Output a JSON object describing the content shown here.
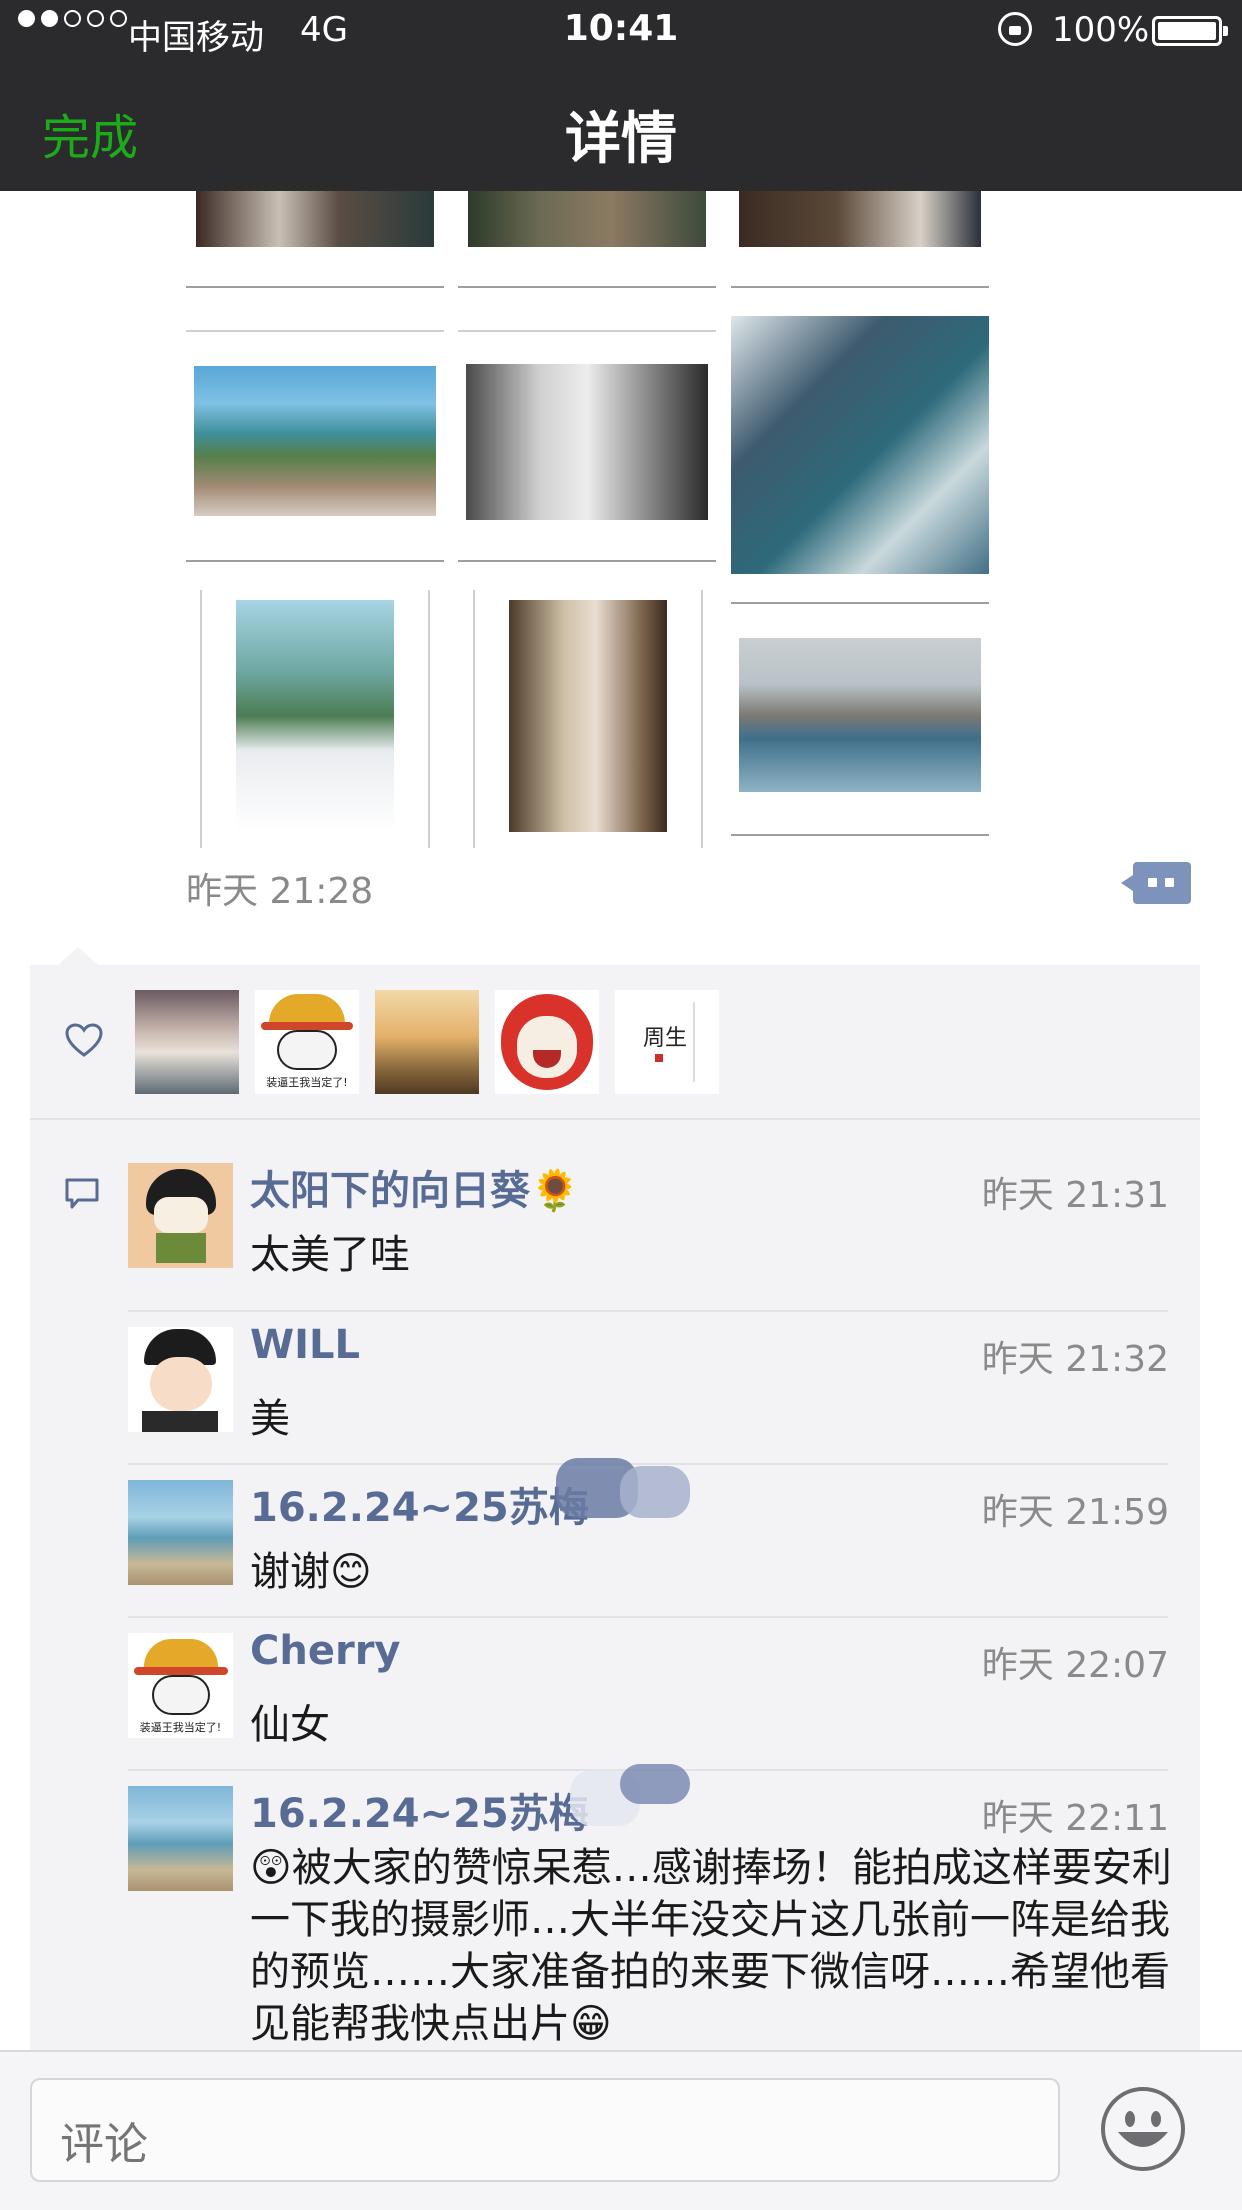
{
  "status_bar": {
    "carrier": "中国移动",
    "network": "4G",
    "time": "10:41",
    "battery": "100%"
  },
  "nav": {
    "done": "完成",
    "title": "详情"
  },
  "post": {
    "time": "昨天 21:28"
  },
  "likes": {
    "icon": "heart-icon",
    "avatars": [
      "avatar-1",
      "avatar-2",
      "avatar-3",
      "avatar-4",
      "avatar-5"
    ],
    "avatar_captions": [
      "装逼王我当定了!",
      "周生"
    ]
  },
  "comments": [
    {
      "name": "太阳下的向日葵🌻",
      "time": "昨天 21:31",
      "text": "太美了哇"
    },
    {
      "name": "WILL",
      "time": "昨天 21:32",
      "text": "美"
    },
    {
      "name": "16.2.24~25苏梅",
      "time": "昨天 21:59",
      "text": "谢谢😊"
    },
    {
      "name": "Cherry",
      "time": "昨天 22:07",
      "text": "仙女",
      "avatar_caption": "装逼王我当定了!"
    },
    {
      "name": "16.2.24~25苏梅",
      "time": "昨天 22:11",
      "text": "😲被大家的赞惊呆惹…感谢捧场！能拍成这样要安利一下我的摄影师…大半年没交片这几张前一阵是给我的预览……大家准备拍的来要下微信呀……希望他看见能帮我快点出片😁"
    }
  ],
  "input": {
    "placeholder": "评论"
  },
  "colors": {
    "nav_bg": "#2b2b2e",
    "accent_green": "#1aad19",
    "name_blue": "#576b95",
    "panel_bg": "#f3f3f5"
  }
}
